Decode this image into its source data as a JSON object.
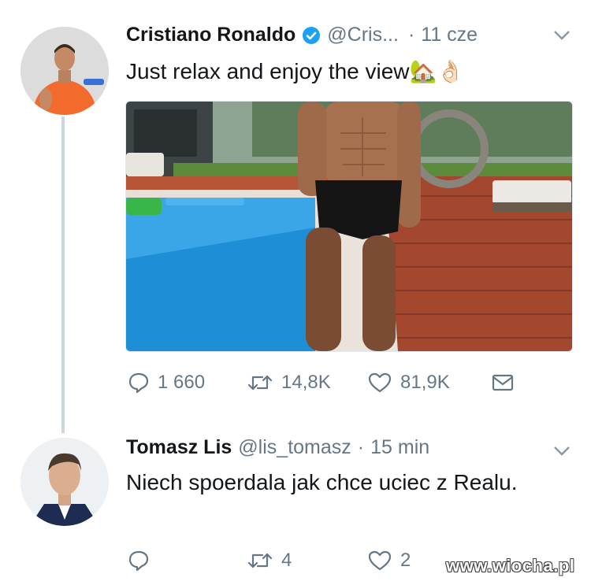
{
  "tweet1": {
    "author_name": "Cristiano Ronaldo",
    "handle": "@Cris...",
    "separator": "·",
    "time": "11 cze",
    "text": "Just relax and enjoy the view🏡👌🏻",
    "verified": true,
    "actions": {
      "replies": "1 660",
      "retweets": "14,8K",
      "likes": "81,9K"
    }
  },
  "tweet2": {
    "author_name": "Tomasz Lis",
    "handle": "@lis_tomasz",
    "separator": "·",
    "time": "15 min",
    "text": "Niech spoerdala jak chce uciec z Realu.",
    "actions": {
      "replies": "",
      "retweets": "4",
      "likes": "2"
    }
  },
  "watermark": "www.wiocha.pl",
  "colors": {
    "verified": "#1da1f2",
    "secondary_text": "#657786",
    "thread_line": "#ccd6dd"
  },
  "icons": [
    "verified-badge-icon",
    "chevron-down-icon",
    "reply-icon",
    "retweet-icon",
    "like-icon",
    "message-icon"
  ]
}
